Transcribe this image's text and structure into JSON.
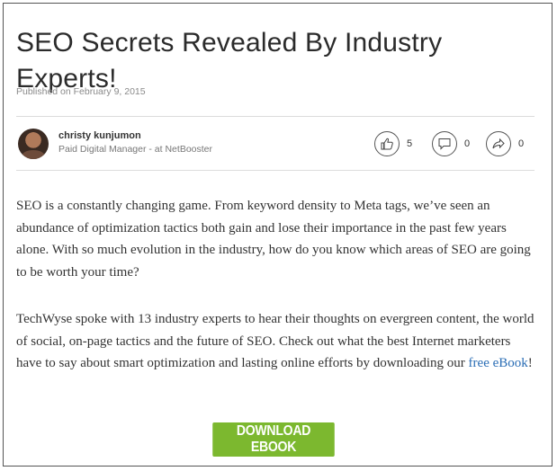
{
  "article": {
    "title": "SEO Secrets Revealed By Industry Experts!",
    "published": "Published on February 9, 2015",
    "author": {
      "name": "christy kunjumon",
      "role": "Paid Digital Manager - at NetBooster"
    },
    "actions": {
      "likes": "5",
      "comments": "0",
      "shares": "0"
    },
    "paragraph1": "SEO is a constantly changing game. From keyword density to Meta tags, we’ve seen an abundance of optimization tactics both gain and lose their importance in the past few years alone. With so much evolution in the industry, how do you know which areas of SEO are going to be worth your time?",
    "paragraph2_before": "TechWyse spoke with 13 industry experts to hear their thoughts on evergreen content, the world of social, on-page tactics and the future of SEO. Check out what the best Internet marketers have to say about smart optimization and lasting online efforts by downloading our ",
    "paragraph2_link": "free eBook",
    "paragraph2_after": "!",
    "cta_label": "DOWNLOAD EBOOK"
  },
  "colors": {
    "cta_background": "#7cb82f",
    "link": "#2a6db5",
    "text": "#333333"
  },
  "icons": {
    "like": "thumbs-up-icon",
    "comment": "comment-icon",
    "share": "share-icon"
  }
}
